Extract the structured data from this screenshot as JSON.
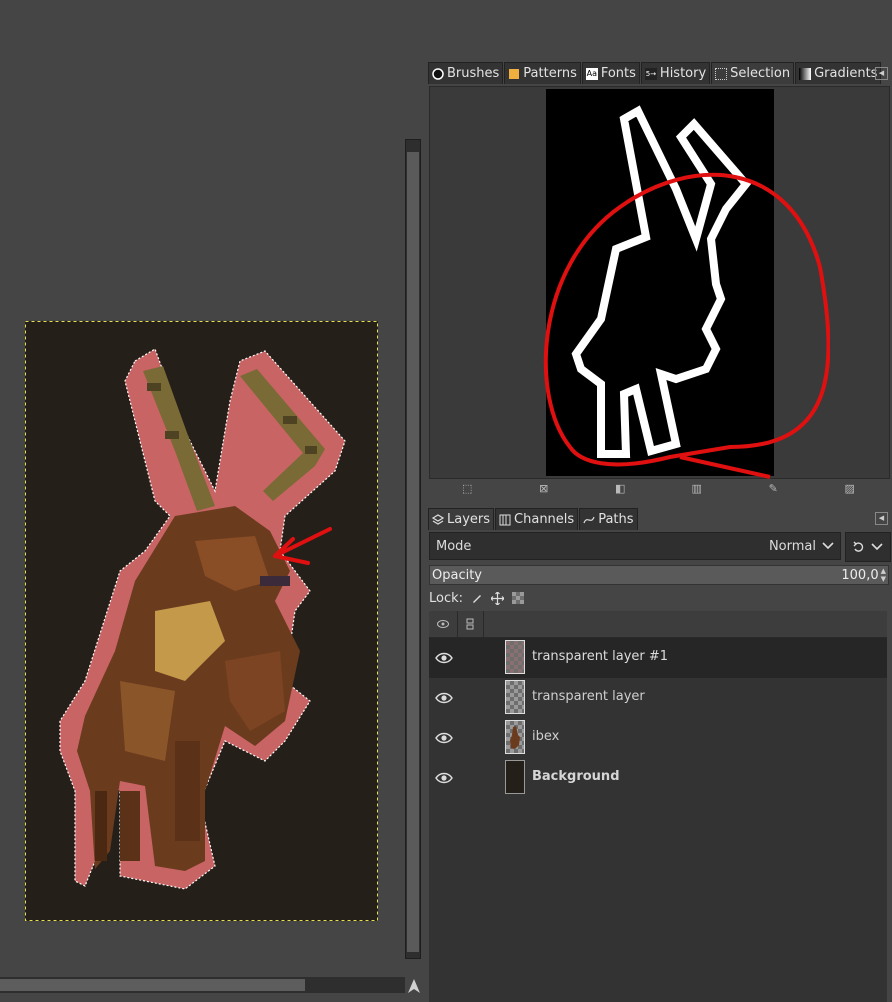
{
  "dock_tabs": [
    {
      "label": "Brushes",
      "icon": "brushes-icon"
    },
    {
      "label": "Patterns",
      "icon": "patterns-icon"
    },
    {
      "label": "Fonts",
      "icon": "fonts-icon"
    },
    {
      "label": "History",
      "icon": "history-icon"
    },
    {
      "label": "Selection",
      "icon": "selection-icon"
    },
    {
      "label": "Gradients",
      "icon": "gradients-icon"
    }
  ],
  "fonts_icon_text": "Aa",
  "history_icon_text": "5→",
  "layers_tabs": [
    {
      "label": "Layers",
      "icon": "layers-icon"
    },
    {
      "label": "Channels",
      "icon": "channels-icon"
    },
    {
      "label": "Paths",
      "icon": "paths-icon"
    }
  ],
  "mode": {
    "label": "Mode",
    "value": "Normal"
  },
  "opacity": {
    "label": "Opacity",
    "value": "100,0"
  },
  "lock": {
    "label": "Lock:"
  },
  "layers": [
    {
      "name": "transparent layer #1",
      "selected": true,
      "thumb": "checker",
      "bold": false
    },
    {
      "name": "transparent layer",
      "selected": false,
      "thumb": "checker",
      "bold": false
    },
    {
      "name": "ibex",
      "selected": false,
      "thumb": "ibex",
      "bold": false
    },
    {
      "name": "Background",
      "selected": false,
      "thumb": "dark",
      "bold": true
    }
  ],
  "colors": {
    "canvas_bg": "#241f19",
    "selection_outline": "#c86464",
    "annotation_red": "#e01010",
    "ibex_brown": "#6b3b1e",
    "horn_olive": "#7a6a35"
  }
}
